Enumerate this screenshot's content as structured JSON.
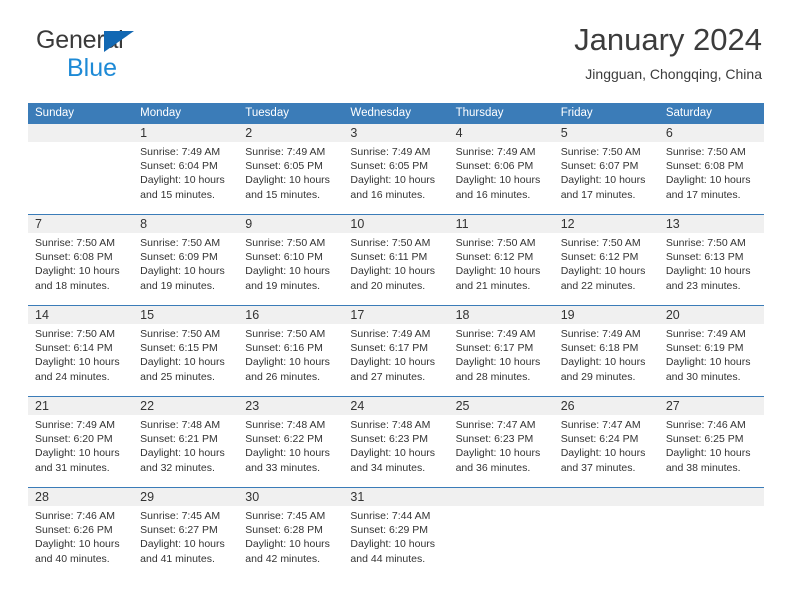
{
  "brand": {
    "name_part1": "General",
    "name_part2": "Blue",
    "triangle_icon": "triangle-icon",
    "colors": {
      "dark": "#3a3a3a",
      "blue": "#1e8ad6",
      "triangle": "#1268b3"
    }
  },
  "header": {
    "title": "January 2024",
    "subtitle": "Jingguan, Chongqing, China"
  },
  "theme": {
    "header_blue": "#3b7cb8",
    "daynum_band": "#f0f0f0",
    "text": "#333333"
  },
  "calendar": {
    "weekday_headers": [
      "Sunday",
      "Monday",
      "Tuesday",
      "Wednesday",
      "Thursday",
      "Friday",
      "Saturday"
    ],
    "weeks": [
      [
        {
          "day": ""
        },
        {
          "day": "1",
          "sunrise": "Sunrise: 7:49 AM",
          "sunset": "Sunset: 6:04 PM",
          "daylight": "Daylight: 10 hours and 15 minutes."
        },
        {
          "day": "2",
          "sunrise": "Sunrise: 7:49 AM",
          "sunset": "Sunset: 6:05 PM",
          "daylight": "Daylight: 10 hours and 15 minutes."
        },
        {
          "day": "3",
          "sunrise": "Sunrise: 7:49 AM",
          "sunset": "Sunset: 6:05 PM",
          "daylight": "Daylight: 10 hours and 16 minutes."
        },
        {
          "day": "4",
          "sunrise": "Sunrise: 7:49 AM",
          "sunset": "Sunset: 6:06 PM",
          "daylight": "Daylight: 10 hours and 16 minutes."
        },
        {
          "day": "5",
          "sunrise": "Sunrise: 7:50 AM",
          "sunset": "Sunset: 6:07 PM",
          "daylight": "Daylight: 10 hours and 17 minutes."
        },
        {
          "day": "6",
          "sunrise": "Sunrise: 7:50 AM",
          "sunset": "Sunset: 6:08 PM",
          "daylight": "Daylight: 10 hours and 17 minutes."
        }
      ],
      [
        {
          "day": "7",
          "sunrise": "Sunrise: 7:50 AM",
          "sunset": "Sunset: 6:08 PM",
          "daylight": "Daylight: 10 hours and 18 minutes."
        },
        {
          "day": "8",
          "sunrise": "Sunrise: 7:50 AM",
          "sunset": "Sunset: 6:09 PM",
          "daylight": "Daylight: 10 hours and 19 minutes."
        },
        {
          "day": "9",
          "sunrise": "Sunrise: 7:50 AM",
          "sunset": "Sunset: 6:10 PM",
          "daylight": "Daylight: 10 hours and 19 minutes."
        },
        {
          "day": "10",
          "sunrise": "Sunrise: 7:50 AM",
          "sunset": "Sunset: 6:11 PM",
          "daylight": "Daylight: 10 hours and 20 minutes."
        },
        {
          "day": "11",
          "sunrise": "Sunrise: 7:50 AM",
          "sunset": "Sunset: 6:12 PM",
          "daylight": "Daylight: 10 hours and 21 minutes."
        },
        {
          "day": "12",
          "sunrise": "Sunrise: 7:50 AM",
          "sunset": "Sunset: 6:12 PM",
          "daylight": "Daylight: 10 hours and 22 minutes."
        },
        {
          "day": "13",
          "sunrise": "Sunrise: 7:50 AM",
          "sunset": "Sunset: 6:13 PM",
          "daylight": "Daylight: 10 hours and 23 minutes."
        }
      ],
      [
        {
          "day": "14",
          "sunrise": "Sunrise: 7:50 AM",
          "sunset": "Sunset: 6:14 PM",
          "daylight": "Daylight: 10 hours and 24 minutes."
        },
        {
          "day": "15",
          "sunrise": "Sunrise: 7:50 AM",
          "sunset": "Sunset: 6:15 PM",
          "daylight": "Daylight: 10 hours and 25 minutes."
        },
        {
          "day": "16",
          "sunrise": "Sunrise: 7:50 AM",
          "sunset": "Sunset: 6:16 PM",
          "daylight": "Daylight: 10 hours and 26 minutes."
        },
        {
          "day": "17",
          "sunrise": "Sunrise: 7:49 AM",
          "sunset": "Sunset: 6:17 PM",
          "daylight": "Daylight: 10 hours and 27 minutes."
        },
        {
          "day": "18",
          "sunrise": "Sunrise: 7:49 AM",
          "sunset": "Sunset: 6:17 PM",
          "daylight": "Daylight: 10 hours and 28 minutes."
        },
        {
          "day": "19",
          "sunrise": "Sunrise: 7:49 AM",
          "sunset": "Sunset: 6:18 PM",
          "daylight": "Daylight: 10 hours and 29 minutes."
        },
        {
          "day": "20",
          "sunrise": "Sunrise: 7:49 AM",
          "sunset": "Sunset: 6:19 PM",
          "daylight": "Daylight: 10 hours and 30 minutes."
        }
      ],
      [
        {
          "day": "21",
          "sunrise": "Sunrise: 7:49 AM",
          "sunset": "Sunset: 6:20 PM",
          "daylight": "Daylight: 10 hours and 31 minutes."
        },
        {
          "day": "22",
          "sunrise": "Sunrise: 7:48 AM",
          "sunset": "Sunset: 6:21 PM",
          "daylight": "Daylight: 10 hours and 32 minutes."
        },
        {
          "day": "23",
          "sunrise": "Sunrise: 7:48 AM",
          "sunset": "Sunset: 6:22 PM",
          "daylight": "Daylight: 10 hours and 33 minutes."
        },
        {
          "day": "24",
          "sunrise": "Sunrise: 7:48 AM",
          "sunset": "Sunset: 6:23 PM",
          "daylight": "Daylight: 10 hours and 34 minutes."
        },
        {
          "day": "25",
          "sunrise": "Sunrise: 7:47 AM",
          "sunset": "Sunset: 6:23 PM",
          "daylight": "Daylight: 10 hours and 36 minutes."
        },
        {
          "day": "26",
          "sunrise": "Sunrise: 7:47 AM",
          "sunset": "Sunset: 6:24 PM",
          "daylight": "Daylight: 10 hours and 37 minutes."
        },
        {
          "day": "27",
          "sunrise": "Sunrise: 7:46 AM",
          "sunset": "Sunset: 6:25 PM",
          "daylight": "Daylight: 10 hours and 38 minutes."
        }
      ],
      [
        {
          "day": "28",
          "sunrise": "Sunrise: 7:46 AM",
          "sunset": "Sunset: 6:26 PM",
          "daylight": "Daylight: 10 hours and 40 minutes."
        },
        {
          "day": "29",
          "sunrise": "Sunrise: 7:45 AM",
          "sunset": "Sunset: 6:27 PM",
          "daylight": "Daylight: 10 hours and 41 minutes."
        },
        {
          "day": "30",
          "sunrise": "Sunrise: 7:45 AM",
          "sunset": "Sunset: 6:28 PM",
          "daylight": "Daylight: 10 hours and 42 minutes."
        },
        {
          "day": "31",
          "sunrise": "Sunrise: 7:44 AM",
          "sunset": "Sunset: 6:29 PM",
          "daylight": "Daylight: 10 hours and 44 minutes."
        },
        {
          "day": ""
        },
        {
          "day": ""
        },
        {
          "day": ""
        }
      ]
    ]
  }
}
